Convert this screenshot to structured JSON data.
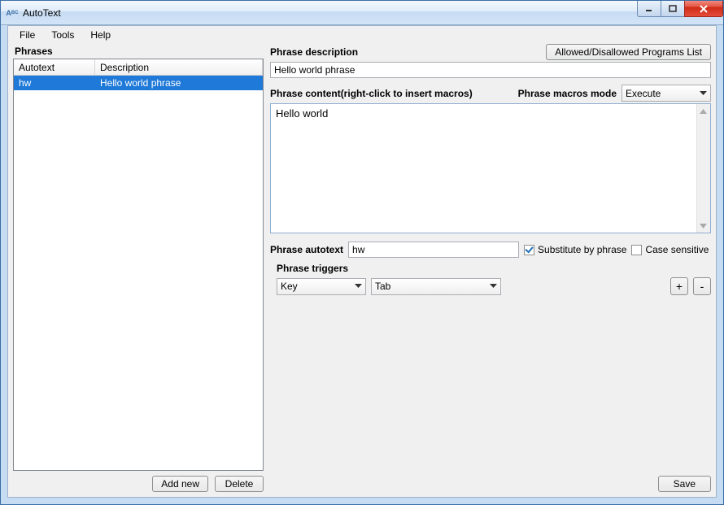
{
  "window": {
    "title": "AutoText"
  },
  "menu": {
    "file": "File",
    "tools": "Tools",
    "help": "Help"
  },
  "left": {
    "heading": "Phrases",
    "columns": {
      "autotext": "Autotext",
      "description": "Description"
    },
    "rows": [
      {
        "autotext": "hw",
        "description": "Hello world phrase"
      }
    ],
    "add_btn": "Add new",
    "delete_btn": "Delete"
  },
  "right": {
    "desc_label": "Phrase description",
    "desc_value": "Hello world phrase",
    "programs_btn": "Allowed/Disallowed Programs List",
    "content_label": "Phrase content(right-click to insert macros)",
    "macros_mode_label": "Phrase macros mode",
    "macros_mode_value": "Execute",
    "content_value": "Hello world",
    "autotext_label": "Phrase autotext",
    "autotext_value": "hw",
    "substitute_label": "Substitute by phrase",
    "substitute_checked": true,
    "case_label": "Case sensitive",
    "case_checked": false,
    "triggers_label": "Phrase triggers",
    "trigger_type": "Key",
    "trigger_value": "Tab",
    "add_trigger": "+",
    "remove_trigger": "-",
    "save_btn": "Save"
  }
}
